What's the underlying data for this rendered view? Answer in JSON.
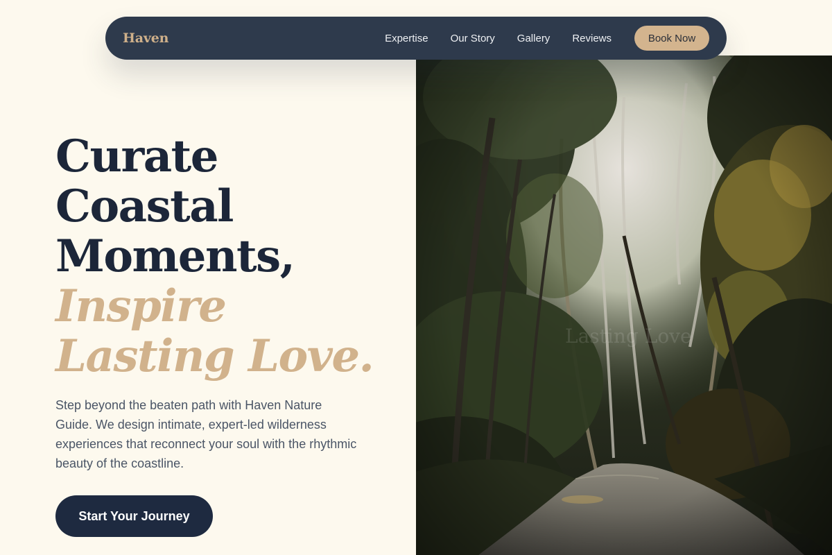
{
  "brand": {
    "name": "Haven"
  },
  "nav": {
    "links": [
      {
        "label": "Expertise"
      },
      {
        "label": "Our Story"
      },
      {
        "label": "Gallery"
      },
      {
        "label": "Reviews"
      }
    ],
    "cta_label": "Book Now"
  },
  "hero": {
    "headline_lines": [
      "Curate",
      "Coastal",
      "Moments,"
    ],
    "accent_lines": [
      "Inspire",
      "Lasting Love."
    ],
    "description": "Step beyond the beaten path with Haven Nature Guide. We design intimate, expert-led wilderness experiences that reconnect your soul with the rhythmic beauty of the coastline.",
    "cta_label": "Start Your Journey",
    "image_watermark": "Lasting Love"
  },
  "colors": {
    "page_background": "#fdf9ee",
    "nav_background": "#2e3a4c",
    "accent_gold": "#d1b28c",
    "headline_navy": "#1c2639",
    "cta_navy": "#1e2a40"
  }
}
